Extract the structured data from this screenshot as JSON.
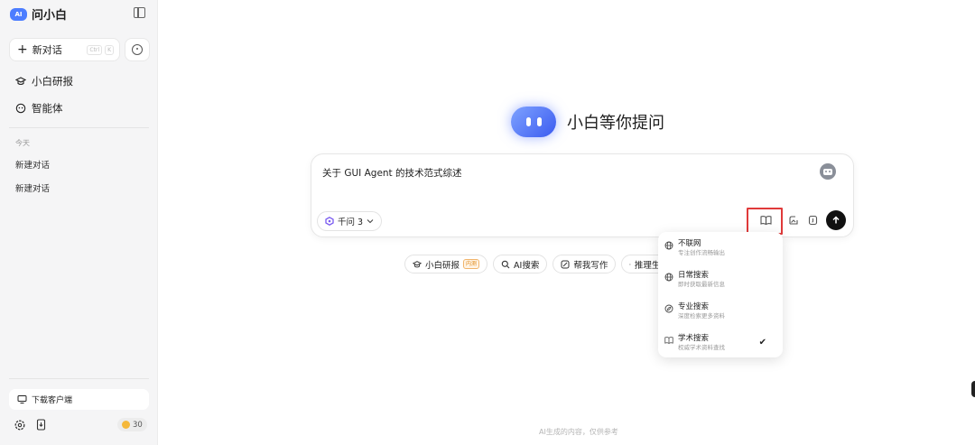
{
  "app": {
    "name": "问小白",
    "logo_text": "AI"
  },
  "sidebar": {
    "new_chat_label": "新对话",
    "new_chat_shortcut": [
      "Ctrl",
      "K"
    ],
    "nav": [
      {
        "label": "小白研报",
        "icon": "mortarboard-icon"
      },
      {
        "label": "智能体",
        "icon": "agent-icon"
      }
    ],
    "section_label": "今天",
    "history": [
      "新建对话",
      "新建对话"
    ],
    "download_label": "下载客户端",
    "points": "30"
  },
  "main": {
    "hero_title": "小白等你提问",
    "input_text": "关于 GUI Agent 的技术范式综述",
    "model_label": "千问 3",
    "chips": [
      {
        "label": "小白研报",
        "badge": "内测"
      },
      {
        "label": "AI搜索"
      },
      {
        "label": "帮我写作"
      },
      {
        "label": "推理生"
      }
    ],
    "footer_note": "AI生成的内容，仅供参考"
  },
  "search_menu": {
    "items": [
      {
        "title": "不联网",
        "desc": "专注创作流畅输出",
        "icon": "globe-off-icon",
        "selected": false
      },
      {
        "title": "日常搜索",
        "desc": "即时获取最新信息",
        "icon": "globe-icon",
        "selected": false
      },
      {
        "title": "专业搜索",
        "desc": "深度检索更多资料",
        "icon": "compass-icon",
        "selected": false
      },
      {
        "title": "学术搜索",
        "desc": "权威学术资料查找",
        "icon": "book-icon",
        "selected": true
      }
    ]
  },
  "colors": {
    "accent": "#4c7dff",
    "highlight_box": "#e03a3a",
    "send": "#111111"
  }
}
